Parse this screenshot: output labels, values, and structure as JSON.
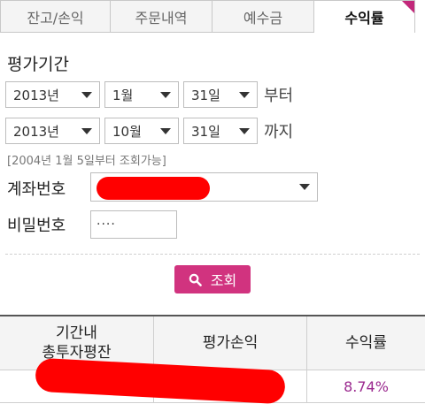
{
  "tabs": [
    {
      "label": "잔고/손익"
    },
    {
      "label": "주문내역"
    },
    {
      "label": "예수금"
    },
    {
      "label": "수익률",
      "active": true
    }
  ],
  "section_title": "평가기간",
  "from": {
    "year": "2013년",
    "month": "1월",
    "day": "31일",
    "suffix": "부터"
  },
  "to": {
    "year": "2013년",
    "month": "10월",
    "day": "31일",
    "suffix": "까지"
  },
  "hint": "[2004년 1월 5일부터 조회가능]",
  "account": {
    "label": "계좌번호",
    "value": ""
  },
  "password": {
    "label": "비밀번호",
    "value": "····"
  },
  "search_button": {
    "label": "조회"
  },
  "colors": {
    "accent": "#d1337f",
    "rate_text": "#9b2a8f"
  },
  "table": {
    "headers": [
      "기간내\n총투자평잔",
      "평가손익",
      "수익률"
    ],
    "rows": [
      {
        "investment": "",
        "profit": "",
        "rate": "8.74%"
      }
    ]
  }
}
